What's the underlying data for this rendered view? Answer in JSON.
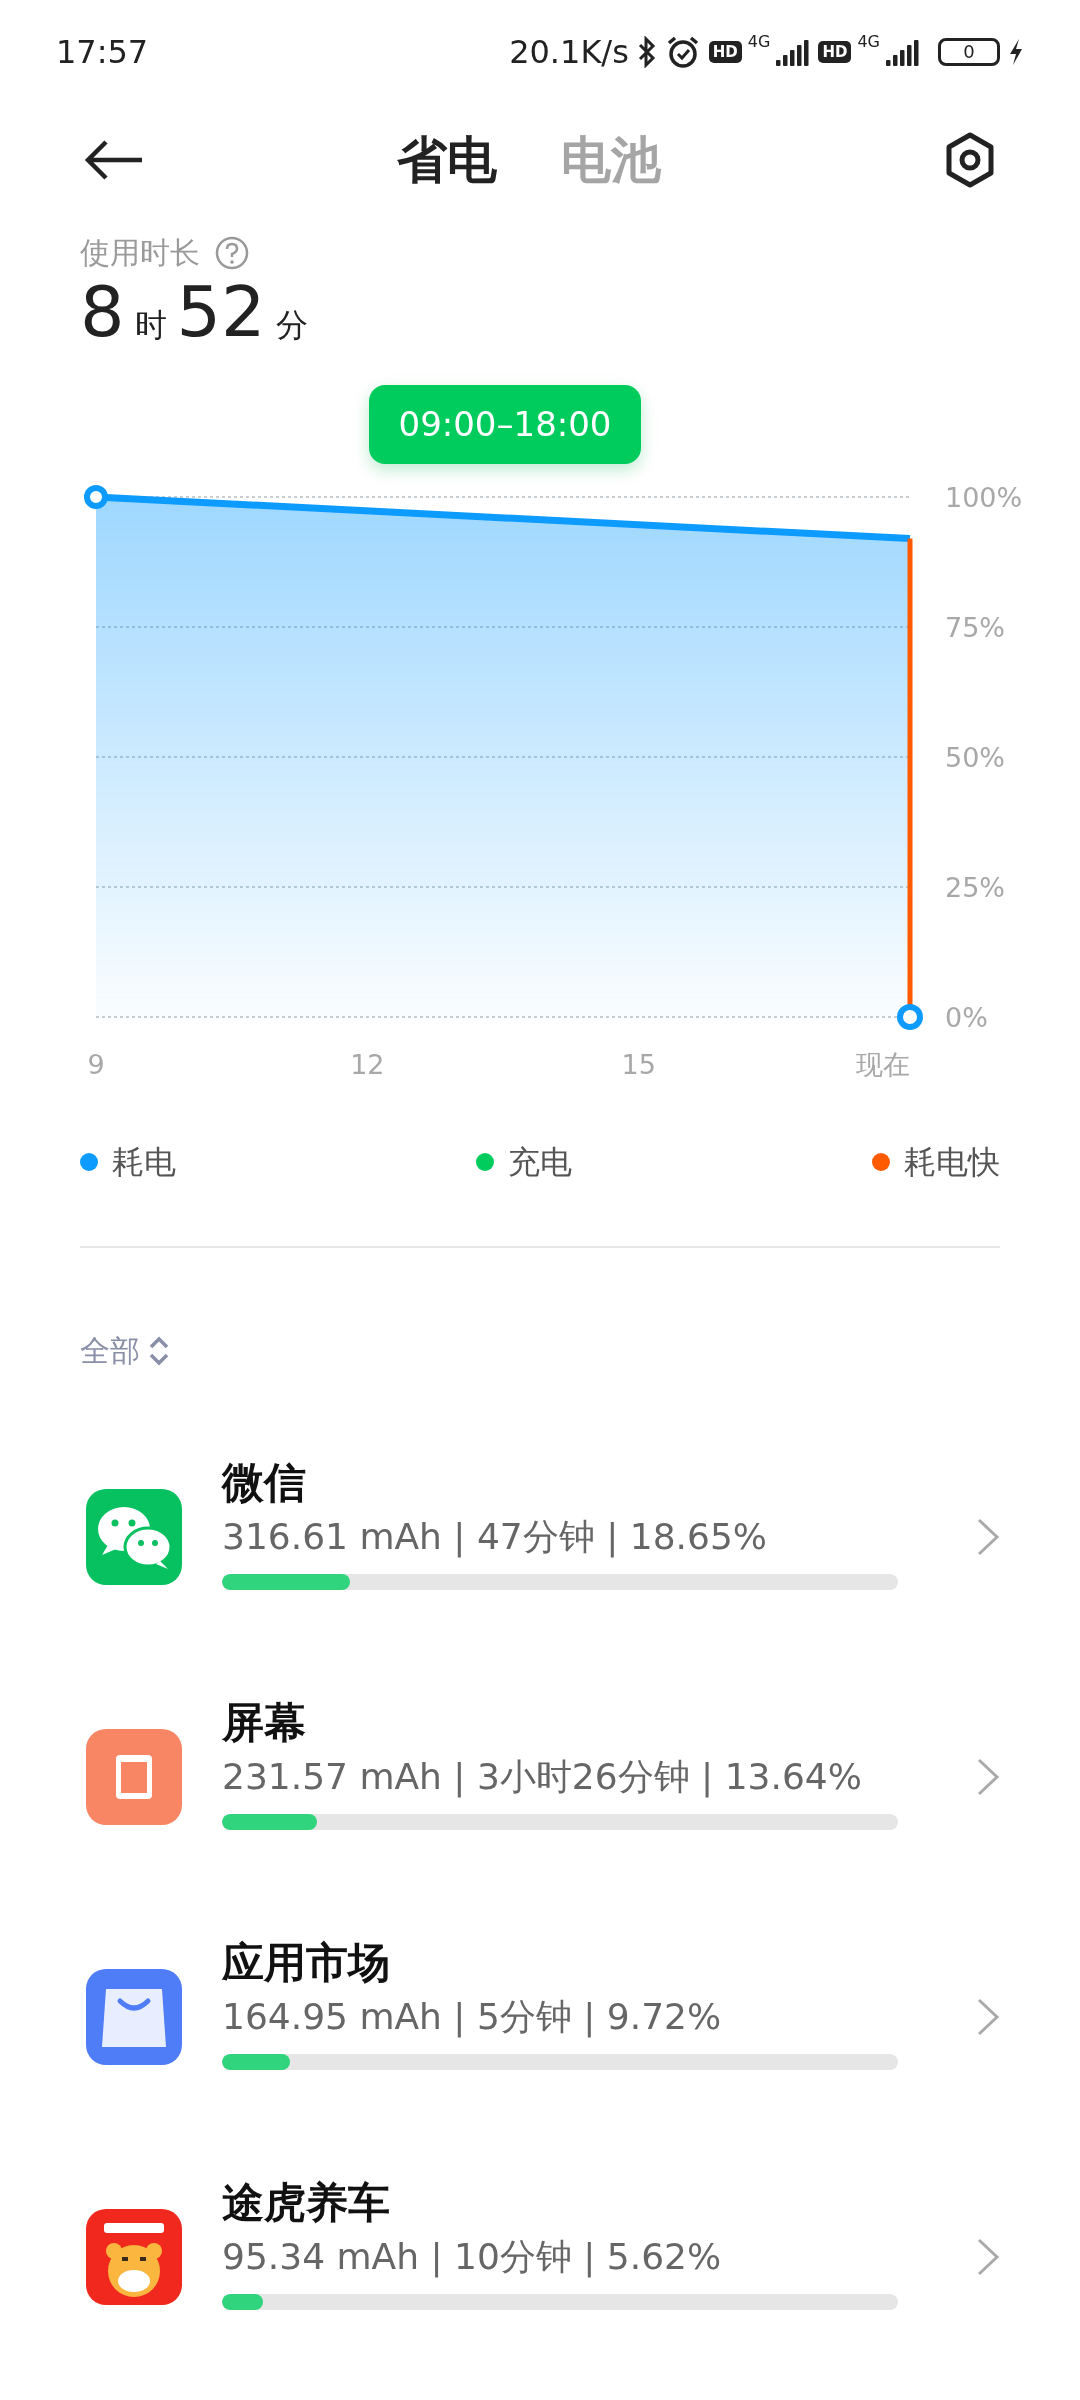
{
  "status_bar": {
    "time": "17:57",
    "net_speed": "20.1K/s",
    "sims": [
      {
        "hd": "HD",
        "network": "4G"
      },
      {
        "hd": "HD",
        "network": "4G"
      }
    ],
    "battery": "0"
  },
  "tabs": [
    {
      "label": "省电",
      "selected": true
    },
    {
      "label": "电池",
      "selected": false
    }
  ],
  "usage": {
    "label": "使用时长",
    "hours": "8",
    "hours_unit": "时",
    "minutes": "52",
    "minutes_unit": "分"
  },
  "range_badge": "09:00–18:00",
  "chart_data": {
    "type": "area",
    "x": [
      9,
      18
    ],
    "series": [
      {
        "name": "耗电",
        "color": "#0d9bff",
        "values": [
          100,
          92
        ]
      }
    ],
    "grid": true,
    "xlim": [
      9,
      18
    ],
    "ylim": [
      0,
      100
    ],
    "xticks": [
      9,
      12,
      15,
      {
        "value": 18,
        "label": "现在"
      }
    ],
    "yticks": [
      {
        "value": 100,
        "label": "100%"
      },
      {
        "value": 75,
        "label": "75%"
      },
      {
        "value": 50,
        "label": "50%"
      },
      {
        "value": 25,
        "label": "25%"
      },
      {
        "value": 0,
        "label": "0%"
      }
    ]
  },
  "legend": [
    {
      "label": "充电",
      "color": "#00cc5e"
    },
    {
      "label": "耗电快",
      "color": "#ff5a00"
    }
  ],
  "filter": "全部",
  "apps": [
    {
      "kind": "chat",
      "name": "微信",
      "detail": "316.61 mAh | 47分钟 | 18.65%",
      "level": 0.19
    },
    {
      "kind": "screen",
      "name": "屏幕",
      "detail": "231.57 mAh | 3小时26分钟 | 13.64%",
      "level": 0.14
    },
    {
      "kind": "store",
      "name": "应用市场",
      "detail": "164.95 mAh | 5分钟 | 9.72%",
      "level": 0.1
    },
    {
      "kind": "tiger",
      "name": "途虎养车",
      "detail": "95.34 mAh | 10分钟 | 5.62%",
      "level": 0.06
    }
  ]
}
